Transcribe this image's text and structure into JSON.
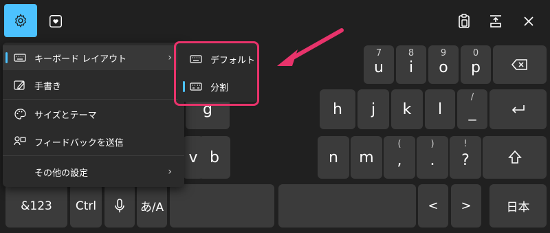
{
  "toolbar": {
    "settings_icon": "gear-icon",
    "emoji_icon": "heart-sticker-icon",
    "clipboard_icon": "clipboard-icon",
    "dock_icon": "dock-icon",
    "close_icon": "close-icon",
    "accent": "#4cc2ff"
  },
  "menu": {
    "items": [
      {
        "label": "キーボード レイアウト",
        "icon": "keyboard-icon",
        "has_submenu": true,
        "active": true
      },
      {
        "label": "手書き",
        "icon": "pen-icon",
        "has_submenu": false
      },
      {
        "label": "サイズとテーマ",
        "icon": "palette-icon",
        "has_submenu": false
      },
      {
        "label": "フィードバックを送信",
        "icon": "feedback-icon",
        "has_submenu": false
      },
      {
        "label": "その他の設定",
        "icon": "",
        "has_submenu": true
      }
    ]
  },
  "submenu": {
    "items": [
      {
        "label": "デフォルト",
        "icon": "keyboard-icon",
        "selected": false
      },
      {
        "label": "分割",
        "icon": "split-keyboard-icon",
        "selected": true
      }
    ],
    "highlight_color": "#e8336b"
  },
  "keys": {
    "row1": [
      {
        "main": "u",
        "sup": "7"
      },
      {
        "main": "i",
        "sup": "8"
      },
      {
        "main": "o",
        "sup": "9"
      },
      {
        "main": "p",
        "sup": "0"
      },
      {
        "main": "",
        "icon": "backspace-icon"
      }
    ],
    "row2_left": [
      {
        "main": "g"
      }
    ],
    "row2": [
      {
        "main": "h"
      },
      {
        "main": "j"
      },
      {
        "main": "k"
      },
      {
        "main": "l"
      },
      {
        "main": "_",
        "sup": "/"
      },
      {
        "main": "",
        "icon": "enter-icon"
      }
    ],
    "row3_left": [
      {
        "main": "v"
      },
      {
        "main": "b"
      }
    ],
    "row3": [
      {
        "main": "n"
      },
      {
        "main": "m"
      },
      {
        "main": ",",
        "sup": "("
      },
      {
        "main": ".",
        "sup": ")"
      },
      {
        "main": "?",
        "sup": "!"
      },
      {
        "main": "",
        "icon": "shift-icon"
      }
    ],
    "row4": {
      "numsym": "&123",
      "ctrl": "Ctrl",
      "mic_icon": "microphone-icon",
      "ime": "あ/A",
      "left_arrow": "<",
      "right_arrow": ">",
      "lang": "日本"
    }
  },
  "annotation": {
    "color": "#e8336b"
  }
}
